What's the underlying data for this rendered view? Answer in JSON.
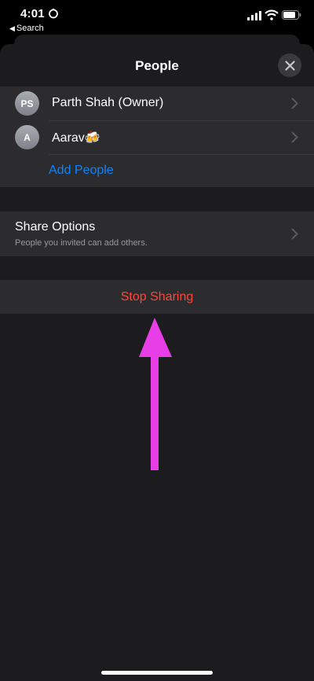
{
  "status_bar": {
    "time": "4:01",
    "back_label": "Search"
  },
  "sheet": {
    "title": "People",
    "people": [
      {
        "initials": "PS",
        "name": "Parth Shah (Owner)"
      },
      {
        "initials": "A",
        "name": "Aarav🍻"
      }
    ],
    "add_people_label": "Add People",
    "share_options": {
      "title": "Share Options",
      "subtitle": "People you invited can add others."
    },
    "stop_sharing_label": "Stop Sharing"
  },
  "colors": {
    "accent_blue": "#0a84ff",
    "destructive_red": "#ff453a",
    "annotation_arrow": "#e83ee8"
  }
}
